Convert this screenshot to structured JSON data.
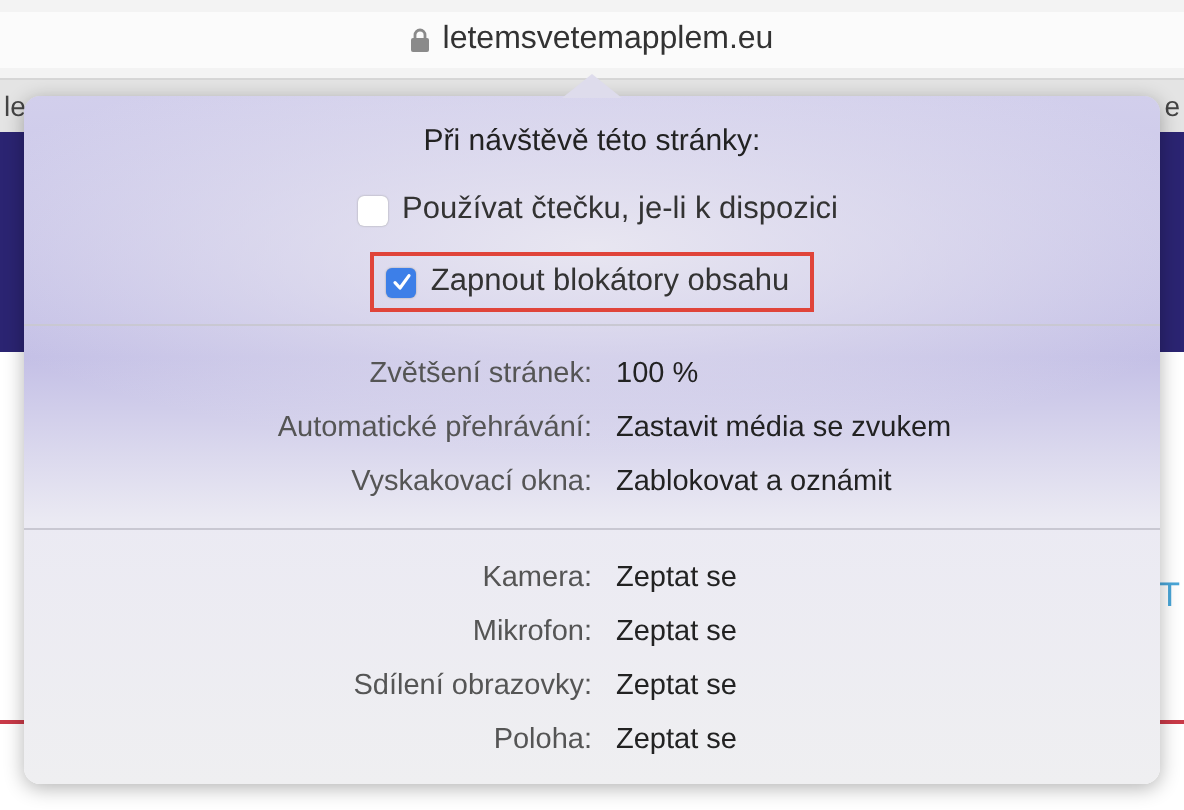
{
  "browser": {
    "url": "letemsvetemapplem.eu",
    "secure": true
  },
  "page_fragments": {
    "tab_left": "le",
    "tab_right": "e",
    "nav_right": "T"
  },
  "popover": {
    "title": "Při návštěvě této stránky:",
    "options": [
      {
        "label": "Používat čtečku, je-li k dispozici",
        "checked": false,
        "highlighted": false
      },
      {
        "label": "Zapnout blokátory obsahu",
        "checked": true,
        "highlighted": true
      }
    ],
    "sections": [
      {
        "settings": [
          {
            "label": "Zvětšení stránek:",
            "value": "100 %"
          },
          {
            "label": "Automatické přehrávání:",
            "value": "Zastavit média se zvukem"
          },
          {
            "label": "Vyskakovací okna:",
            "value": "Zablokovat a oznámit"
          }
        ]
      },
      {
        "settings": [
          {
            "label": "Kamera:",
            "value": "Zeptat se"
          },
          {
            "label": "Mikrofon:",
            "value": "Zeptat se"
          },
          {
            "label": "Sdílení obrazovky:",
            "value": "Zeptat se"
          },
          {
            "label": "Poloha:",
            "value": "Zeptat se"
          }
        ]
      }
    ]
  }
}
